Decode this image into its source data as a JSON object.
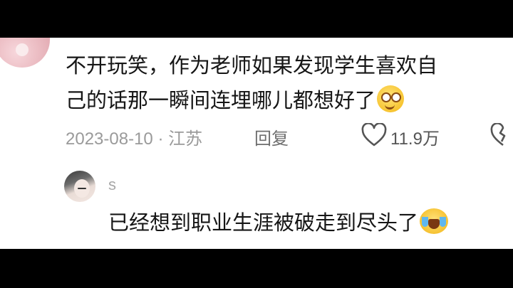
{
  "comment": {
    "lines": [
      "不开玩笑，作为老师如果发现学生喜欢自",
      "己的话那一瞬间连埋哪儿都想好了"
    ],
    "emoji": "smile-icon",
    "date": "2023-08-10",
    "separator": "·",
    "location": "江苏",
    "reply_label": "回复",
    "like_count": "11.9万"
  },
  "reply": {
    "username": "s",
    "text": "已经想到职业生涯被破走到尽头了",
    "emoji": "crying-laugh-icon"
  },
  "colors": {
    "background": "#ffffff",
    "letterbox": "#000000",
    "text": "#161616",
    "meta": "#9a9a9a"
  }
}
